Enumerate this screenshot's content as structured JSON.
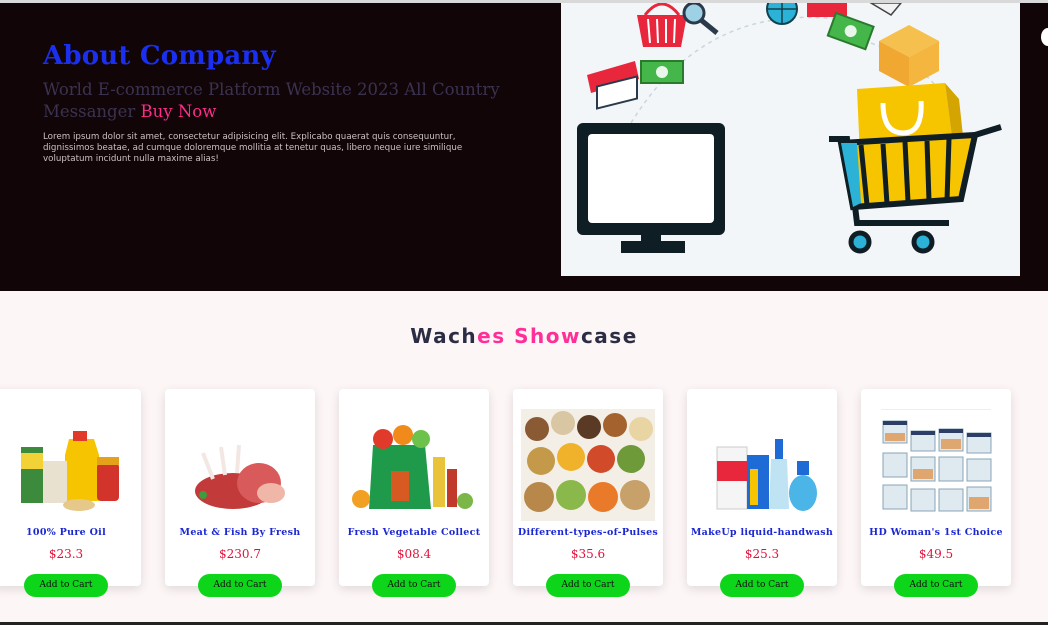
{
  "hero": {
    "title": "About Company",
    "subtitle": "World E-commerce Platform Website 2023 All Country Messanger",
    "buy_now": "Buy Now",
    "paragraph": "Lorem ipsum dolor sit amet, consectetur adipisicing elit. Explicabo quaerat quis consequuntur, dignissimos beatae, ad cumque doloremque mollitia at tenetur quas, libero neque iure similique voluptatum incidunt nulla maxime alias!"
  },
  "showcase": {
    "title_part1": "Wach",
    "title_part2": "es Show",
    "title_part3": "case"
  },
  "products": [
    {
      "name": "100% Pure Oil",
      "price": "$23.3",
      "button": "Add to Cart",
      "icon": "oil-grocery-image"
    },
    {
      "name": "Meat & Fish By Fresh",
      "price": "$230.7",
      "button": "Add to Cart",
      "icon": "meat-image"
    },
    {
      "name": "Fresh Vegetable Collect",
      "price": "$08.4",
      "button": "Add to Cart",
      "icon": "vegetable-bag-image"
    },
    {
      "name": "Different-types-of-Pulses",
      "price": "$35.6",
      "button": "Add to Cart",
      "icon": "pulses-image"
    },
    {
      "name": "MakeUp liquid-handwash",
      "price": "$25.3",
      "button": "Add to Cart",
      "icon": "handwash-image"
    },
    {
      "name": "HD Woman's 1st Choice",
      "price": "$49.5",
      "button": "Add to Cart",
      "icon": "storage-jars-image"
    }
  ],
  "colors": {
    "hero_bg": "#120508",
    "title_blue": "#1a2ff0",
    "accent_pink": "#ff2f98",
    "price_red": "#e0123b",
    "button_green": "#0dd61a"
  }
}
